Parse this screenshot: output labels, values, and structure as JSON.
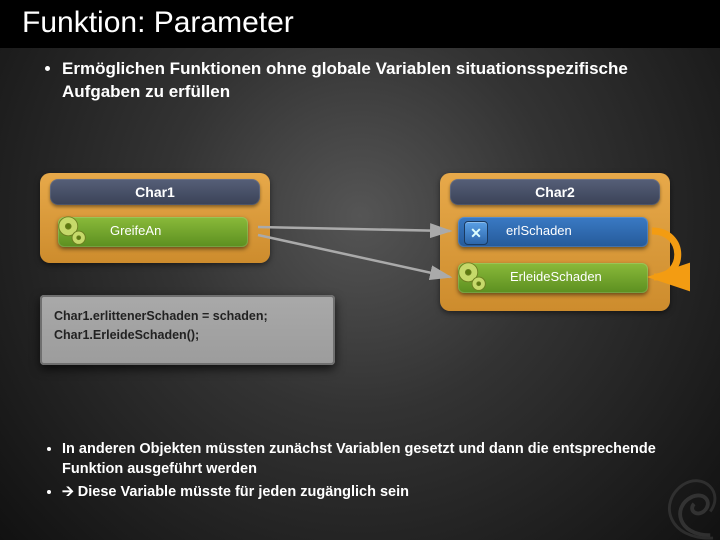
{
  "title": "Funktion: Parameter",
  "bullet1": "Ermöglichen Funktionen ohne globale Variablen situationsspezifische Aufgaben zu erfüllen",
  "char1": {
    "name": "Char1",
    "fn": "GreifeAn"
  },
  "char2": {
    "name": "Char2",
    "var": "erlSchaden",
    "fn": "ErleideSchaden"
  },
  "code": {
    "line1": "Char1.erlittenerSchaden = schaden;",
    "line2": "Char1.ErleideSchaden();"
  },
  "bullet2": "In anderen Objekten müssten zunächst Variablen gesetzt und dann die entsprechende Funktion ausgeführt werden",
  "bullet3": "🡪 Diese Variable müsste für jeden zugänglich sein"
}
